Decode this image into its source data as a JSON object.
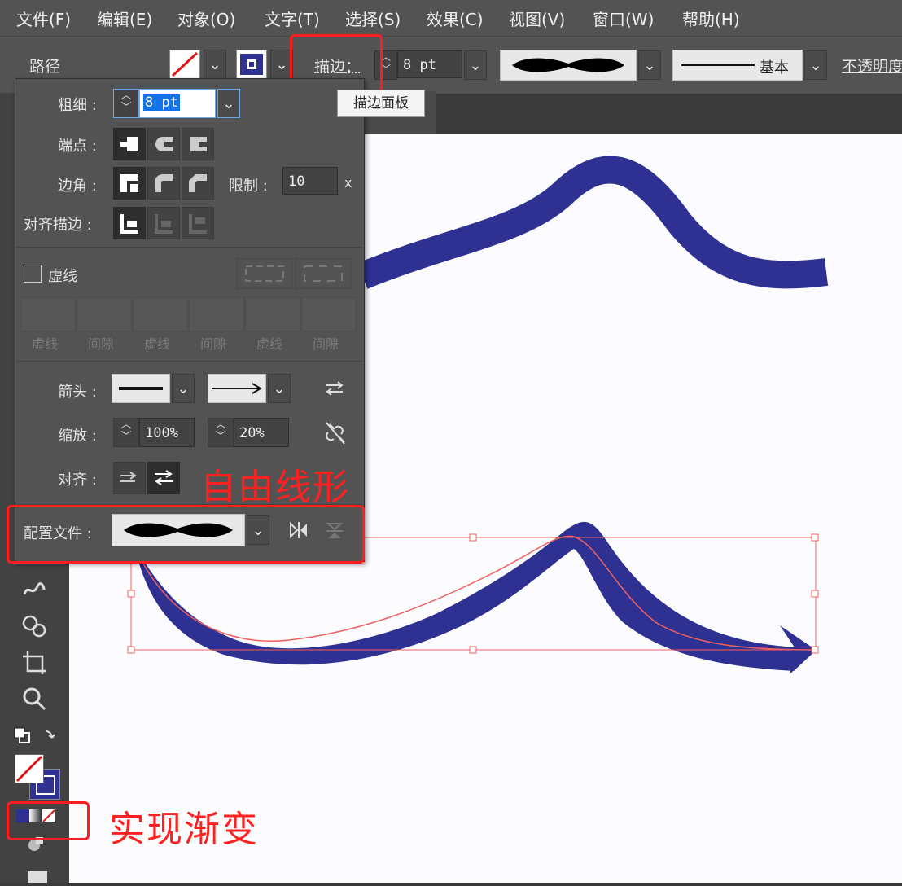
{
  "menu": [
    "文件(F)",
    "编辑(E)",
    "对象(O)",
    "文字(T)",
    "选择(S)",
    "效果(C)",
    "视图(V)",
    "窗口(W)",
    "帮助(H)"
  ],
  "control": {
    "selection_type": "路径",
    "stroke_label": "描边",
    "stroke_weight": "8 pt",
    "tooltip": "描边面板",
    "style_label": "基本",
    "opacity_label": "不透明度"
  },
  "panel": {
    "weight_label": "粗细",
    "weight_value": "8 pt",
    "cap_label": "端点",
    "corner_label": "边角",
    "limit_label": "限制",
    "limit_value": "10",
    "limit_unit": "x",
    "align_stroke_label": "对齐描边",
    "dashed_label": "虚线",
    "dash_fields": [
      "虚线",
      "间隙",
      "虚线",
      "间隙",
      "虚线",
      "间隙"
    ],
    "arrow_label": "箭头",
    "scale_label": "缩放",
    "scale_start": "100%",
    "scale_end": "20%",
    "align_label": "对齐",
    "profile_label": "配置文件"
  },
  "annotations": {
    "freeform": "自由线形",
    "gradient": "实现渐变"
  },
  "colors": {
    "stroke_fill": "#2e3192",
    "highlight": "#ff1c1c",
    "selection": "#f0605e"
  }
}
